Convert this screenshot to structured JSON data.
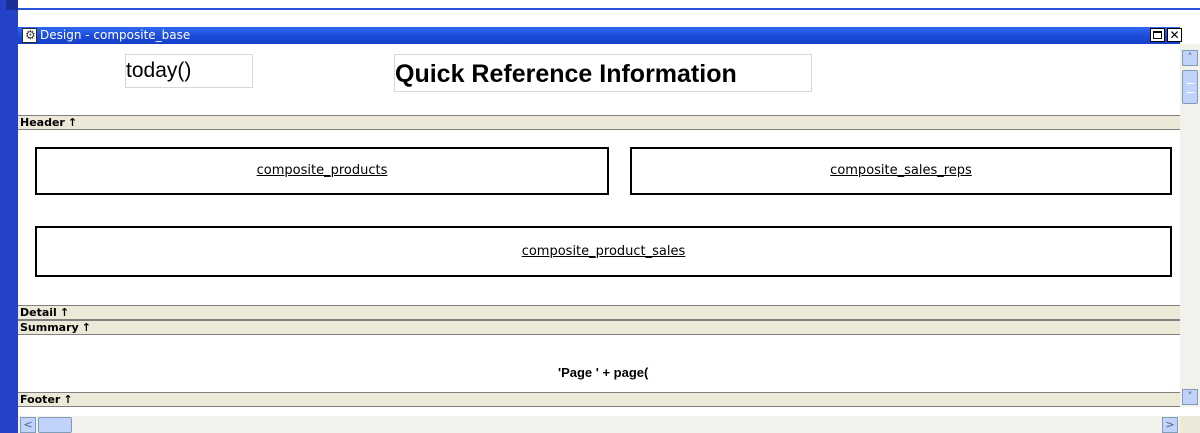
{
  "window": {
    "title": "Design - composite_base",
    "icons": {
      "app": "datawindow-gear-icon",
      "restore": "restore-icon",
      "close": "close-icon"
    }
  },
  "header_band": {
    "today_expr": "today()",
    "report_title": "Quick Reference Information"
  },
  "bands": {
    "header": "Header",
    "detail": "Detail",
    "summary": "Summary",
    "footer": "Footer",
    "arrow": "↑"
  },
  "composites": {
    "products": "composite_products",
    "sales_reps": "composite_sales_reps",
    "product_sales": "composite_product_sales"
  },
  "footer_band": {
    "page_expr": "'Page ' + page("
  },
  "scrollbars": {
    "up": "˄",
    "down": "˅",
    "left": "<",
    "right": ">"
  },
  "colors": {
    "titlebar": "#1c4ad8",
    "band_bg": "#ece9d8",
    "frame_blue": "#2442c8"
  }
}
